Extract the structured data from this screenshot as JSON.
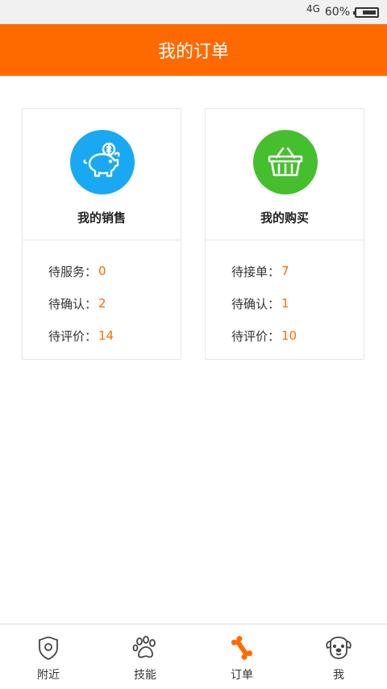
{
  "status": {
    "network": "4G",
    "battery": "60%"
  },
  "header": {
    "title": "我的订单"
  },
  "sales": {
    "title": "我的销售",
    "rows": [
      {
        "label": "待服务：",
        "value": "0"
      },
      {
        "label": "待确认：",
        "value": "2"
      },
      {
        "label": "待评价：",
        "value": "14"
      }
    ]
  },
  "purchases": {
    "title": "我的购买",
    "rows": [
      {
        "label": "待接单：",
        "value": "7"
      },
      {
        "label": "待确认：",
        "value": "1"
      },
      {
        "label": "待评价：",
        "value": "10"
      }
    ]
  },
  "tabbar": {
    "items": [
      {
        "label": "附近",
        "icon": "location-icon"
      },
      {
        "label": "技能",
        "icon": "paw-icon"
      },
      {
        "label": "订单",
        "icon": "bone-icon",
        "active": true
      },
      {
        "label": "我",
        "icon": "dog-face-icon"
      }
    ]
  },
  "colors": {
    "accent": "#ff6a00",
    "sales_icon_bg": "#19a9f2",
    "purchase_icon_bg": "#45bf2e"
  }
}
